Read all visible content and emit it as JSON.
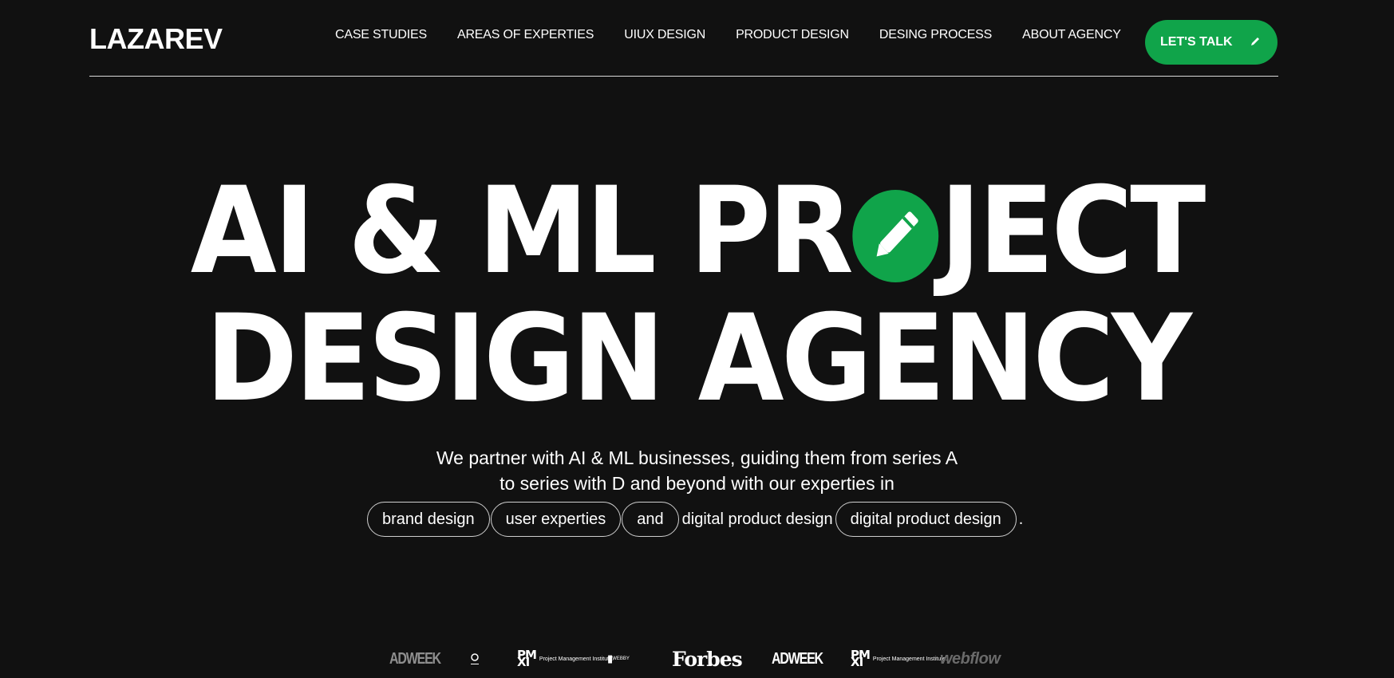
{
  "header": {
    "logo": "LAZAREV",
    "nav": [
      "CASE STUDIES",
      "AREAS OF EXPERTIES",
      "UIUX DESIGN",
      "PRODUCT DESIGN",
      "DESING PROCESS",
      "ABOUT AGENCY"
    ],
    "cta_label": "LET'S TALK"
  },
  "hero": {
    "line1_before": "AI & ML PR",
    "line1_after": "JECT",
    "line2": "DESIGN AGENCY",
    "accent_color": "#10a44a"
  },
  "description": {
    "line1": "We partner with AI & ML businesses, guiding them from series A",
    "line2": "to series with D and beyond with our experties in",
    "chips": [
      "brand design",
      "user experties",
      "and"
    ],
    "plain_text": "digital product design",
    "last_chip": "digital product design",
    "end_punct": "."
  },
  "logos": {
    "items": [
      "ADWEEK",
      "",
      "Project Management Institute.",
      "WEBBY",
      "Forbes",
      "ADWEEK",
      "Project Management Institute.",
      "webflow"
    ]
  }
}
